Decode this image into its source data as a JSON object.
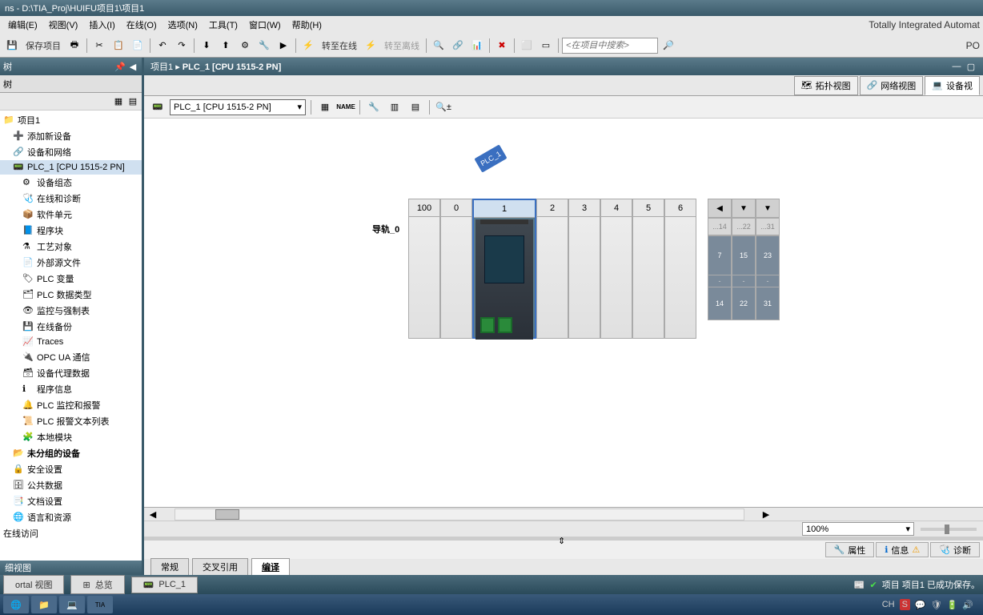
{
  "window": {
    "title": "ns  -  D:\\TIA_Proj\\HUIFU项目1\\项目1"
  },
  "menu": {
    "items": [
      "编辑(E)",
      "视图(V)",
      "插入(I)",
      "在线(O)",
      "选项(N)",
      "工具(T)",
      "窗口(W)",
      "帮助(H)"
    ]
  },
  "brand": "Totally Integrated Automat",
  "brand_sub": "PO",
  "toolbar": {
    "save": "保存项目",
    "go_online": "转至在线",
    "go_offline": "转至离线",
    "search_placeholder": "<在项目中搜索>"
  },
  "sidebar": {
    "header": "树",
    "tab": "树"
  },
  "tree": {
    "root": "项目1",
    "items": [
      {
        "label": "添加新设备",
        "icon": "add"
      },
      {
        "label": "设备和网络",
        "icon": "net"
      },
      {
        "label": "PLC_1 [CPU 1515-2 PN]",
        "icon": "plc",
        "selected": true
      },
      {
        "label": "设备组态",
        "icon": "config",
        "indent": 2
      },
      {
        "label": "在线和诊断",
        "icon": "diag",
        "indent": 2
      },
      {
        "label": "软件单元",
        "icon": "sw",
        "indent": 2
      },
      {
        "label": "程序块",
        "icon": "prog",
        "indent": 2
      },
      {
        "label": "工艺对象",
        "icon": "tech",
        "indent": 2
      },
      {
        "label": "外部源文件",
        "icon": "ext",
        "indent": 2
      },
      {
        "label": "PLC 变量",
        "icon": "var",
        "indent": 2
      },
      {
        "label": "PLC 数据类型",
        "icon": "dtype",
        "indent": 2
      },
      {
        "label": "监控与强制表",
        "icon": "watch",
        "indent": 2
      },
      {
        "label": "在线备份",
        "icon": "backup",
        "indent": 2
      },
      {
        "label": "Traces",
        "icon": "trace",
        "indent": 2
      },
      {
        "label": "OPC UA 通信",
        "icon": "opc",
        "indent": 2
      },
      {
        "label": "设备代理数据",
        "icon": "proxy",
        "indent": 2
      },
      {
        "label": "程序信息",
        "icon": "info",
        "indent": 2
      },
      {
        "label": "PLC 监控和报警",
        "icon": "alarm",
        "indent": 2
      },
      {
        "label": "PLC 报警文本列表",
        "icon": "alarmtxt",
        "indent": 2
      },
      {
        "label": "本地模块",
        "icon": "mod",
        "indent": 2
      },
      {
        "label": "未分组的设备",
        "icon": "ungroup",
        "bold": true
      },
      {
        "label": "安全设置",
        "icon": "sec"
      },
      {
        "label": "公共数据",
        "icon": "common"
      },
      {
        "label": "文档设置",
        "icon": "doc"
      },
      {
        "label": "语言和资源",
        "icon": "lang"
      }
    ],
    "footer1": "在线访问",
    "footer2": "细视图"
  },
  "breadcrumb": {
    "project": "项目1",
    "device": "PLC_1 [CPU 1515-2 PN]"
  },
  "view_tabs": {
    "topology": "拓扑视图",
    "network": "网络视图",
    "device": "设备视"
  },
  "device_dropdown": "PLC_1 [CPU 1515-2 PN]",
  "rack": {
    "label": "导轨_0",
    "tag": "PLC_1",
    "slots": [
      "100",
      "0",
      "1",
      "2",
      "3",
      "4",
      "5",
      "6"
    ],
    "ext": [
      {
        "top": "...14",
        "mid": "7",
        "dash": "-",
        "bot": "14"
      },
      {
        "top": "...22",
        "mid": "15",
        "dash": "-",
        "bot": "22"
      },
      {
        "top": "...31",
        "mid": "23",
        "dash": "-",
        "bot": "31"
      }
    ]
  },
  "zoom": "100%",
  "info_tabs": {
    "props": "属性",
    "info": "信息",
    "diag": "诊断"
  },
  "bottom_tabs": {
    "general": "常规",
    "xref": "交叉引用",
    "compile": "编译"
  },
  "status": {
    "portal": "ortal 视图",
    "overview": "总览",
    "plc": "PLC_1",
    "message": "项目 项目1 已成功保存。"
  },
  "tray": {
    "lang": "CH"
  }
}
